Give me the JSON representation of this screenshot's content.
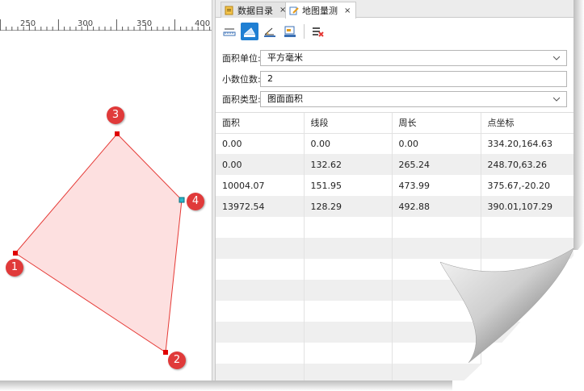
{
  "tabs": [
    {
      "label": "数据目录",
      "icon": "catalog-icon",
      "close": "×",
      "active": false
    },
    {
      "label": "地图量测",
      "icon": "measure-icon",
      "close": "×",
      "active": true
    }
  ],
  "ruler": {
    "labels": [
      "250",
      "300",
      "350",
      "400"
    ]
  },
  "markers": [
    "1",
    "2",
    "3",
    "4"
  ],
  "polygon": {
    "fill": "#fde0e0",
    "stroke": "#e53935"
  },
  "toolbar": {
    "buttons": [
      {
        "icon": "measure-distance-icon",
        "active": false
      },
      {
        "icon": "measure-area-icon",
        "active": true
      },
      {
        "icon": "measure-angle-icon",
        "active": false
      },
      {
        "icon": "measure-coordinate-icon",
        "active": false
      },
      {
        "icon": "clear-results-icon",
        "active": false
      }
    ]
  },
  "form": {
    "area_unit": {
      "label": "面积单位:",
      "value": "平方毫米"
    },
    "decimals": {
      "label": "小数位数:",
      "value": "2"
    },
    "area_type": {
      "label": "面积类型:",
      "value": "图面面积"
    }
  },
  "table": {
    "headers": [
      "面积",
      "线段",
      "周长",
      "点坐标"
    ],
    "rows": [
      [
        "0.00",
        "0.00",
        "0.00",
        "334.20,164.63"
      ],
      [
        "0.00",
        "132.62",
        "265.24",
        "248.70,63.26"
      ],
      [
        "10004.07",
        "151.95",
        "473.99",
        "375.67,-20.20"
      ],
      [
        "13972.54",
        "128.29",
        "492.88",
        "390.01,107.29"
      ]
    ]
  },
  "colors": {
    "accent": "#1f7fd3",
    "marker": "#e03a3a"
  }
}
